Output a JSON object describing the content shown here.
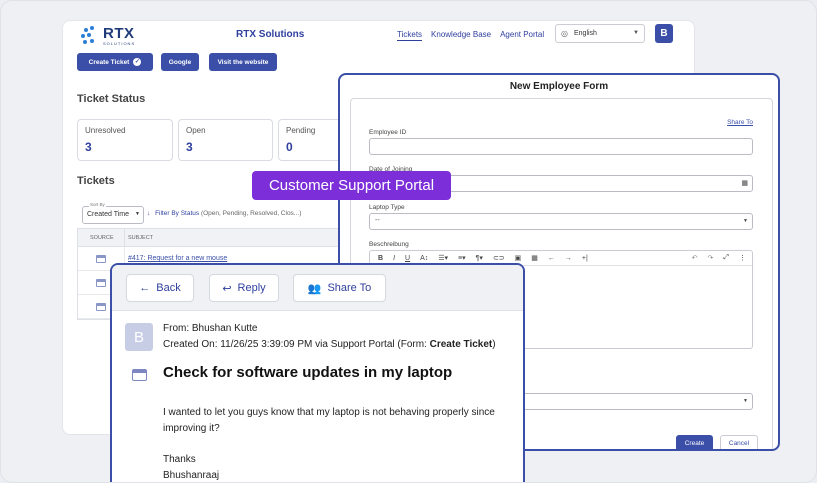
{
  "header": {
    "logo_text": "RTX",
    "logo_sub": "SOLUTIONS",
    "app_title": "RTX Solutions",
    "nav": [
      "Tickets",
      "Knowledge Base",
      "Agent Portal"
    ],
    "language": "English",
    "user_initial": "B"
  },
  "actions": {
    "create_ticket": "Create Ticket",
    "google": "Google",
    "visit_website": "Visit the website"
  },
  "ticket_status": {
    "title": "Ticket Status",
    "stats": [
      {
        "label": "Unresolved",
        "value": "3"
      },
      {
        "label": "Open",
        "value": "3"
      },
      {
        "label": "Pending",
        "value": "0"
      }
    ]
  },
  "tickets": {
    "title": "Tickets",
    "sort_legend": "Sort By",
    "sort_value": "Created Time",
    "filter_label": "Filter By Status",
    "filter_values": "(Open, Pending, Resolved, Clos...)",
    "columns": [
      "SOURCE",
      "SUBJECT"
    ],
    "rows": [
      {
        "subject": "#417: Request for a new mouse"
      },
      {
        "subject": ""
      },
      {
        "subject": ""
      }
    ]
  },
  "form": {
    "title": "New Employee Form",
    "share_to": "Share To",
    "fields": {
      "employee_id": "Employee ID",
      "date_of_joining": "Date of Joining",
      "laptop_type": "Laptop Type",
      "laptop_type_value": "--",
      "description": "Beschreibung"
    },
    "create": "Create",
    "cancel": "Cancel"
  },
  "overlay_label": "Customer Support Portal",
  "ticket_detail": {
    "back": "Back",
    "reply": "Reply",
    "share": "Share To",
    "avatar": "B",
    "from": "From: Bhushan Kutte",
    "created_prefix": "Created On: 11/26/25 3:39:09 PM via Support Portal (Form: ",
    "created_form": "Create Ticket",
    "created_suffix": ")",
    "subject": "Check for software updates in my laptop",
    "body_line1": "I wanted to let you guys know that my laptop is not behaving properly since",
    "body_line2": "improving it?",
    "thanks": "Thanks",
    "signature": "Bhushanraaj"
  },
  "colors": {
    "primary": "#3b4fa8",
    "label_purple": "#7c2fd9"
  }
}
